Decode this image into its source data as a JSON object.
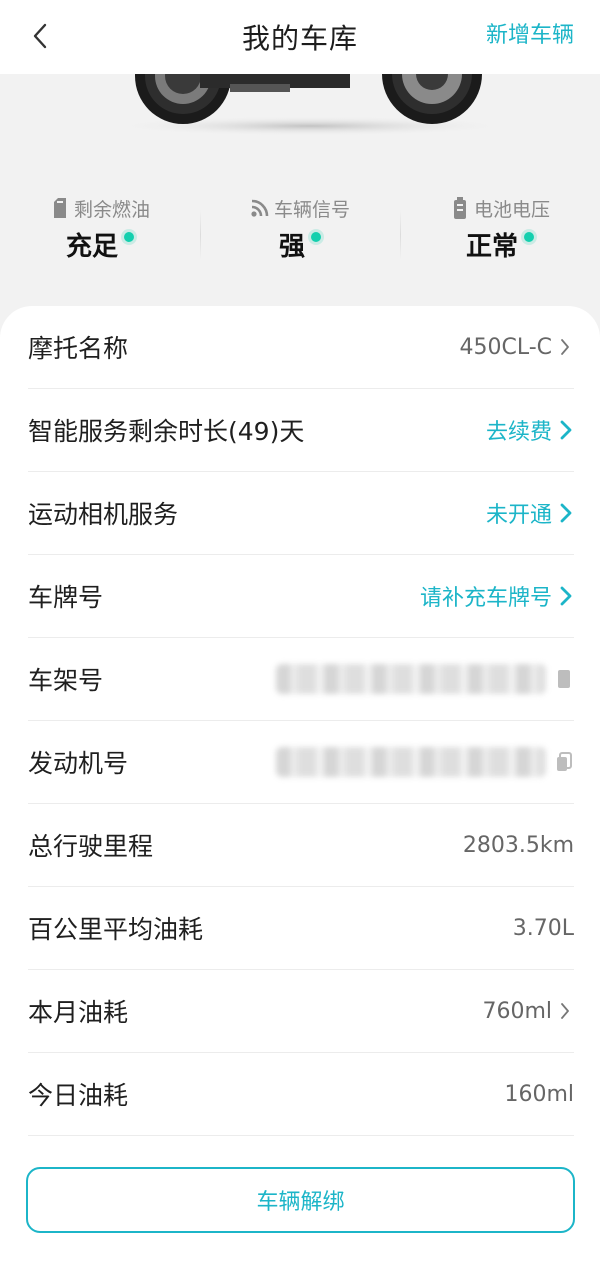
{
  "header": {
    "title": "我的车库",
    "add_label": "新增车辆"
  },
  "colors": {
    "accent": "#1cb5c8",
    "status_dot": "#14cfae"
  },
  "stats": [
    {
      "icon": "fuel-icon",
      "label": "剩余燃油",
      "value": "充足"
    },
    {
      "icon": "signal-icon",
      "label": "车辆信号",
      "value": "强"
    },
    {
      "icon": "battery-icon",
      "label": "电池电压",
      "value": "正常"
    }
  ],
  "rows": {
    "name": {
      "label": "摩托名称",
      "value": "450CL-C"
    },
    "service": {
      "label": "智能服务剩余时长(49)天",
      "value": "去续费"
    },
    "camera": {
      "label": "运动相机服务",
      "value": "未开通"
    },
    "plate": {
      "label": "车牌号",
      "value": "请补充车牌号"
    },
    "frame": {
      "label": "车架号"
    },
    "engine": {
      "label": "发动机号"
    },
    "mileage": {
      "label": "总行驶里程",
      "value": "2803.5km"
    },
    "avg_fuel": {
      "label": "百公里平均油耗",
      "value": "3.70L"
    },
    "month_fuel": {
      "label": "本月油耗",
      "value": "760ml"
    },
    "today_fuel": {
      "label": "今日油耗",
      "value": "160ml"
    }
  },
  "unbind_label": "车辆解绑"
}
